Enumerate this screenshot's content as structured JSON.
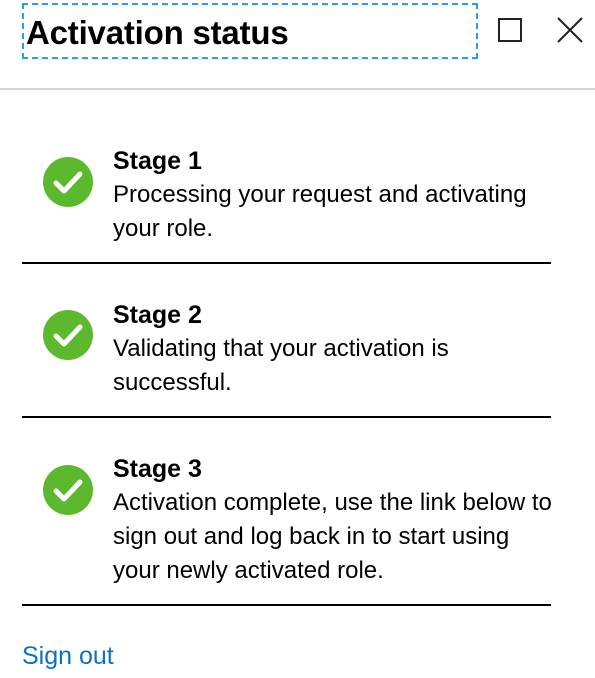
{
  "header": {
    "title": "Activation status"
  },
  "stages": [
    {
      "title": "Stage 1",
      "description": "Processing your request and activating your role."
    },
    {
      "title": "Stage 2",
      "description": "Validating that your activation is successful."
    },
    {
      "title": "Stage 3",
      "description": "Activation complete, use the link below to sign out and log back in to start using your newly activated role."
    }
  ],
  "footer": {
    "sign_out_label": "Sign out"
  },
  "colors": {
    "check_green": "#5cb82d",
    "link_blue": "#0a72c4",
    "focus_outline": "#2aa1e0"
  },
  "icons": {
    "maximize": "maximize-icon",
    "close": "close-icon",
    "status": "check-circle-icon"
  }
}
